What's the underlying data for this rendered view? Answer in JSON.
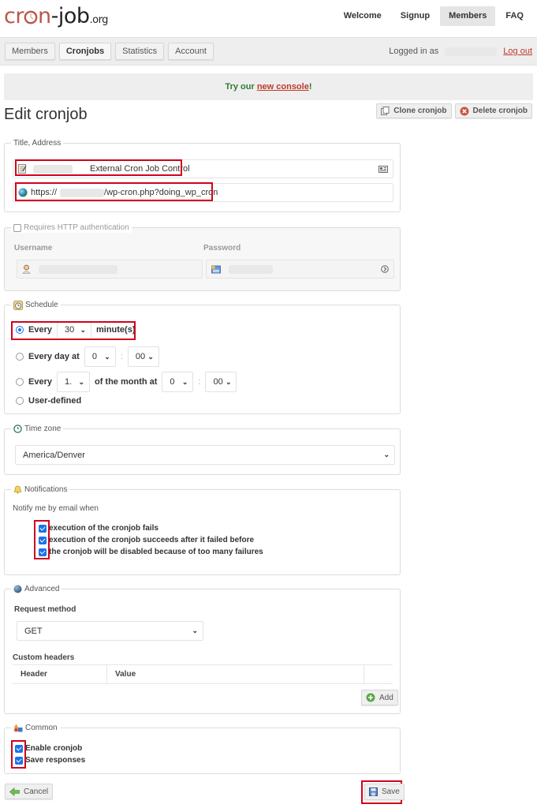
{
  "header": {
    "logo": {
      "part1": "cr",
      "part1b": "n",
      "part2": "-job",
      "part3": ".org"
    },
    "nav": [
      {
        "label": "Welcome",
        "active": false
      },
      {
        "label": "Signup",
        "active": false
      },
      {
        "label": "Members",
        "active": true
      },
      {
        "label": "FAQ",
        "active": false
      }
    ]
  },
  "subnav": {
    "tabs": [
      {
        "label": "Members",
        "active": false
      },
      {
        "label": "Cronjobs",
        "active": true
      },
      {
        "label": "Statistics",
        "active": false
      },
      {
        "label": "Account",
        "active": false
      }
    ],
    "logged_in_label": "Logged in as",
    "logout_label": "Log out"
  },
  "banner": {
    "prefix": "Try our ",
    "link": "new console",
    "suffix": "!"
  },
  "page": {
    "title": "Edit cronjob",
    "clone_label": "Clone cronjob",
    "delete_label": "Delete cronjob"
  },
  "title_address": {
    "legend": "Title, Address",
    "title_value": "External Cron Job Control",
    "url_prefix": "https://",
    "url_suffix": "/wp-cron.php?doing_wp_cron"
  },
  "auth": {
    "legend": "Requires HTTP authentication",
    "checked": false,
    "username_label": "Username",
    "password_label": "Password"
  },
  "schedule": {
    "legend": "Schedule",
    "every_label": "Every",
    "every_value": "30",
    "minutes_label": "minute(s)",
    "every_day_label": "Every day at",
    "day_hour": "0",
    "day_minute": "00",
    "every_month_label": "Every",
    "month_day": "1.",
    "of_month_label": "of the month at",
    "month_hour": "0",
    "month_minute": "00",
    "user_defined_label": "User-defined",
    "colon": ":",
    "selected": "every_minutes"
  },
  "timezone": {
    "legend": "Time zone",
    "value": "America/Denver"
  },
  "notifications": {
    "legend": "Notifications",
    "intro": "Notify me by email when",
    "items": [
      {
        "label": "execution of the cronjob fails",
        "checked": true
      },
      {
        "label": "execution of the cronjob succeeds after it failed before",
        "checked": true
      },
      {
        "label": "the cronjob will be disabled because of too many failures",
        "checked": true
      }
    ]
  },
  "advanced": {
    "legend": "Advanced",
    "request_method_label": "Request method",
    "request_method_value": "GET",
    "custom_headers_label": "Custom headers",
    "columns": [
      "Header",
      "Value"
    ],
    "add_label": "Add"
  },
  "common": {
    "legend": "Common",
    "items": [
      {
        "label": "Enable cronjob",
        "checked": true
      },
      {
        "label": "Save responses",
        "checked": true
      }
    ]
  },
  "footer": {
    "cancel_label": "Cancel",
    "save_label": "Save"
  },
  "colors": {
    "accent_red": "#d0021b",
    "logo_red": "#b9574a",
    "link_red": "#c0392b",
    "banner_green": "#2e7d32",
    "checkbox_blue": "#1a73e8"
  }
}
